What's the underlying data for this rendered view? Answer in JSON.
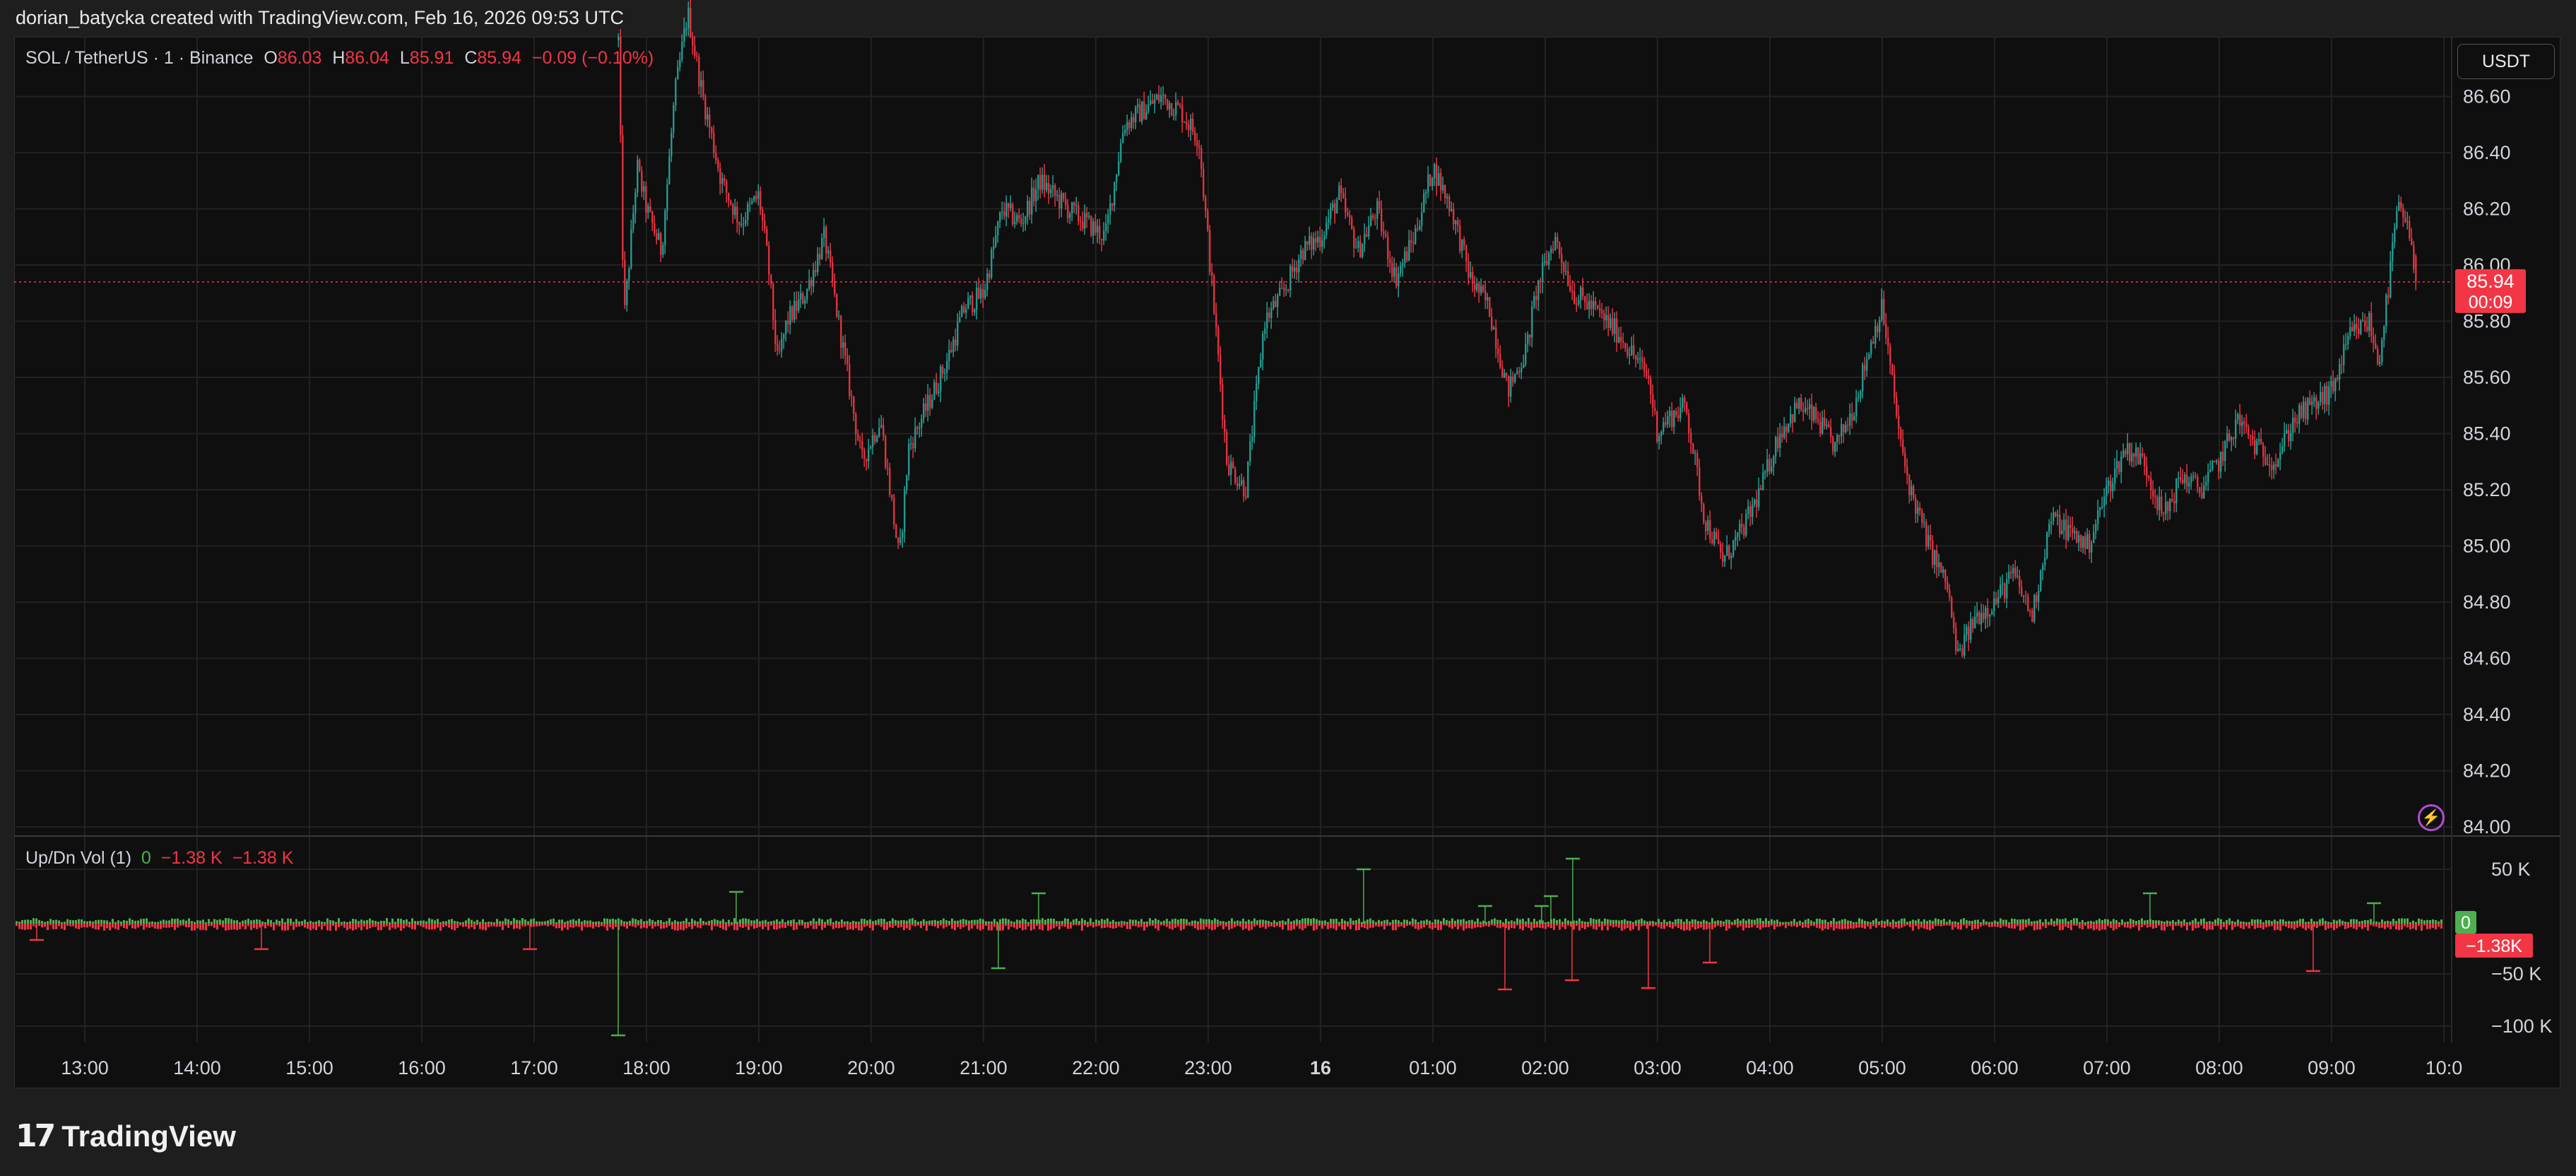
{
  "header": {
    "attribution": "dorian_batycka created with TradingView.com, Feb 16, 2026 09:53 UTC"
  },
  "legend": {
    "symbol": "SOL / TetherUS · 1 · Binance",
    "o_label": "O",
    "o_value": "86.03",
    "h_label": "H",
    "h_value": "86.04",
    "l_label": "L",
    "l_value": "85.91",
    "c_label": "C",
    "c_value": "85.94",
    "change": "−0.09 (−0.10%)"
  },
  "currency_button": "USDT",
  "price_badge": {
    "price": "85.94",
    "countdown": "00:09"
  },
  "volume_indicator": {
    "name": "Up/Dn Vol (1)",
    "up_value": "0",
    "down_value": "−1.38 K",
    "delta_value": "−1.38 K",
    "badge_up": "0",
    "badge_down": "−1.38K"
  },
  "footer": {
    "brand": "TradingView",
    "logo_mark": "17"
  },
  "colors": {
    "up": "#26a69a",
    "down": "#f23645",
    "vol_up": "#4caf50",
    "vol_down": "#f23645",
    "accent": "#b44bd6"
  },
  "icons": {
    "alert": "lightning-bolt-icon"
  },
  "chart_data": {
    "type": "candlestick",
    "symbol": "SOL / TetherUS",
    "interval": "1",
    "exchange": "Binance",
    "y_axis": {
      "ticks": [
        "84.00",
        "84.20",
        "84.40",
        "84.60",
        "84.80",
        "85.00",
        "85.20",
        "85.40",
        "85.60",
        "85.80",
        "86.00",
        "86.20",
        "86.40",
        "86.60"
      ],
      "range": [
        84.0,
        86.7
      ]
    },
    "x_axis": {
      "ticks": [
        "13:00",
        "14:00",
        "15:00",
        "16:00",
        "17:00",
        "18:00",
        "19:00",
        "20:00",
        "21:00",
        "22:00",
        "23:00",
        "16",
        "01:00",
        "02:00",
        "03:00",
        "04:00",
        "05:00",
        "06:00",
        "07:00",
        "08:00",
        "09:00",
        "10:0"
      ]
    },
    "last_price": 85.94,
    "price_path": [
      [
        "17:45",
        86.8
      ],
      [
        "17:48",
        85.8
      ],
      [
        "17:55",
        86.35
      ],
      [
        "18:00",
        86.2
      ],
      [
        "18:08",
        86.05
      ],
      [
        "18:15",
        86.6
      ],
      [
        "18:22",
        86.9
      ],
      [
        "18:30",
        86.6
      ],
      [
        "18:40",
        86.3
      ],
      [
        "18:50",
        86.15
      ],
      [
        "19:00",
        86.25
      ],
      [
        "19:05",
        86.0
      ],
      [
        "19:10",
        85.65
      ],
      [
        "19:15",
        85.8
      ],
      [
        "19:25",
        85.9
      ],
      [
        "19:35",
        86.1
      ],
      [
        "19:45",
        85.7
      ],
      [
        "19:55",
        85.3
      ],
      [
        "20:05",
        85.45
      ],
      [
        "20:10",
        85.2
      ],
      [
        "20:15",
        84.95
      ],
      [
        "20:20",
        85.35
      ],
      [
        "20:30",
        85.5
      ],
      [
        "20:40",
        85.65
      ],
      [
        "20:50",
        85.85
      ],
      [
        "21:00",
        85.9
      ],
      [
        "21:10",
        86.2
      ],
      [
        "21:20",
        86.15
      ],
      [
        "21:30",
        86.3
      ],
      [
        "21:45",
        86.2
      ],
      [
        "21:55",
        86.15
      ],
      [
        "22:05",
        86.1
      ],
      [
        "22:15",
        86.5
      ],
      [
        "22:25",
        86.55
      ],
      [
        "22:35",
        86.6
      ],
      [
        "22:45",
        86.55
      ],
      [
        "22:55",
        86.45
      ],
      [
        "23:05",
        85.7
      ],
      [
        "23:10",
        85.3
      ],
      [
        "23:20",
        85.2
      ],
      [
        "23:30",
        85.8
      ],
      [
        "23:40",
        85.9
      ],
      [
        "23:50",
        86.05
      ],
      [
        "00:00",
        86.1
      ],
      [
        "00:10",
        86.25
      ],
      [
        "00:20",
        86.05
      ],
      [
        "00:30",
        86.2
      ],
      [
        "00:40",
        85.95
      ],
      [
        "00:50",
        86.1
      ],
      [
        "01:00",
        86.35
      ],
      [
        "01:10",
        86.2
      ],
      [
        "01:20",
        85.95
      ],
      [
        "01:30",
        85.85
      ],
      [
        "01:40",
        85.55
      ],
      [
        "01:50",
        85.7
      ],
      [
        "01:55",
        85.9
      ],
      [
        "02:05",
        86.1
      ],
      [
        "02:15",
        85.9
      ],
      [
        "02:25",
        85.85
      ],
      [
        "02:40",
        85.75
      ],
      [
        "02:55",
        85.6
      ],
      [
        "03:00",
        85.4
      ],
      [
        "03:05",
        85.45
      ],
      [
        "03:15",
        85.5
      ],
      [
        "03:25",
        85.1
      ],
      [
        "03:35",
        84.95
      ],
      [
        "03:45",
        85.05
      ],
      [
        "03:55",
        85.2
      ],
      [
        "04:05",
        85.4
      ],
      [
        "04:15",
        85.5
      ],
      [
        "04:25",
        85.45
      ],
      [
        "04:35",
        85.35
      ],
      [
        "04:45",
        85.5
      ],
      [
        "04:55",
        85.75
      ],
      [
        "05:00",
        85.85
      ],
      [
        "05:05",
        85.6
      ],
      [
        "05:10",
        85.35
      ],
      [
        "05:15",
        85.2
      ],
      [
        "05:25",
        85.0
      ],
      [
        "05:35",
        84.85
      ],
      [
        "05:40",
        84.6
      ],
      [
        "05:50",
        84.75
      ],
      [
        "06:00",
        84.8
      ],
      [
        "06:10",
        84.9
      ],
      [
        "06:20",
        84.75
      ],
      [
        "06:30",
        85.1
      ],
      [
        "06:40",
        85.05
      ],
      [
        "06:50",
        85.0
      ],
      [
        "07:00",
        85.2
      ],
      [
        "07:10",
        85.35
      ],
      [
        "07:20",
        85.3
      ],
      [
        "07:30",
        85.1
      ],
      [
        "07:40",
        85.25
      ],
      [
        "07:50",
        85.2
      ],
      [
        "08:00",
        85.3
      ],
      [
        "08:10",
        85.45
      ],
      [
        "08:20",
        85.35
      ],
      [
        "08:30",
        85.3
      ],
      [
        "08:40",
        85.45
      ],
      [
        "08:50",
        85.5
      ],
      [
        "09:00",
        85.55
      ],
      [
        "09:10",
        85.75
      ],
      [
        "09:20",
        85.8
      ],
      [
        "09:25",
        85.65
      ],
      [
        "09:30",
        85.9
      ],
      [
        "09:35",
        86.2
      ],
      [
        "09:40",
        86.15
      ],
      [
        "09:45",
        85.95
      ]
    ],
    "volume_axis": {
      "ticks": [
        "50 K",
        "−50 K",
        "−100 K"
      ]
    }
  }
}
